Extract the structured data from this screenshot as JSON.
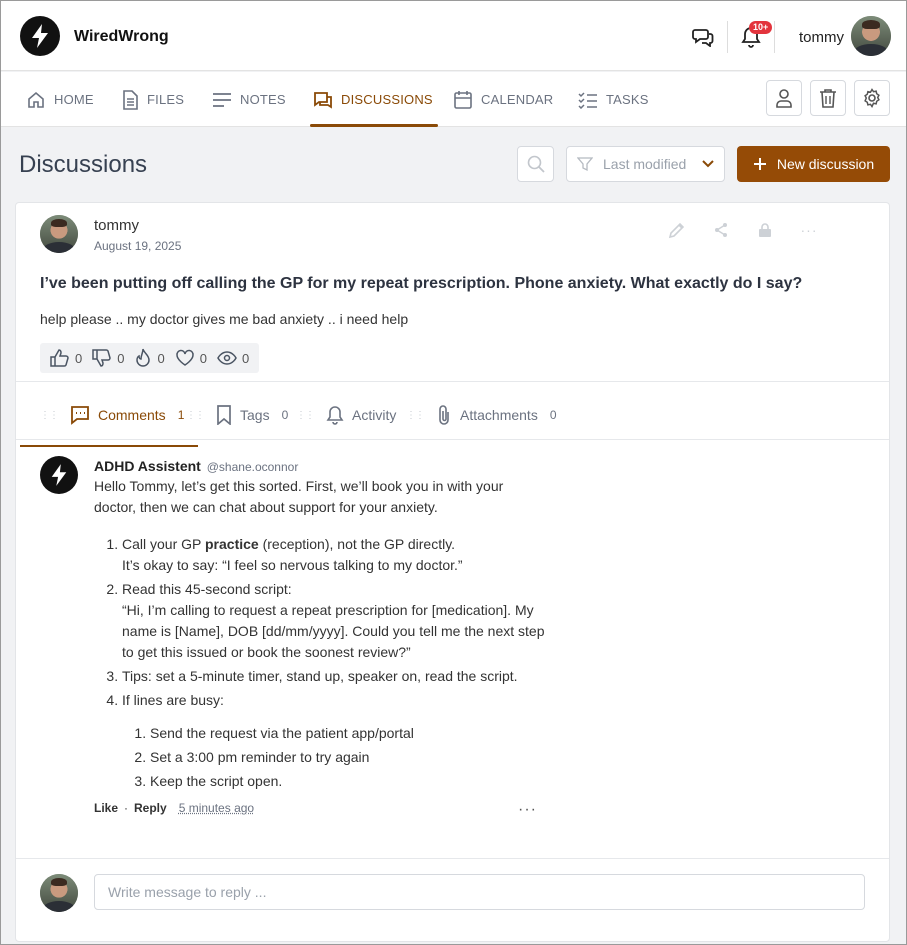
{
  "app": {
    "brand": "WiredWrong",
    "notification_badge": "10+",
    "username": "tommy"
  },
  "nav": {
    "items": [
      {
        "label": "HOME",
        "icon": "home-icon"
      },
      {
        "label": "FILES",
        "icon": "file-icon"
      },
      {
        "label": "NOTES",
        "icon": "notes-icon"
      },
      {
        "label": "DISCUSSIONS",
        "icon": "discussions-icon",
        "active": true
      },
      {
        "label": "CALENDAR",
        "icon": "calendar-icon"
      },
      {
        "label": "TASKS",
        "icon": "tasks-icon"
      }
    ],
    "action_icons": [
      "user-icon",
      "trash-icon",
      "gear-icon"
    ]
  },
  "page": {
    "title": "Discussions",
    "sort_label": "Last modified",
    "new_button_label": "New discussion"
  },
  "post": {
    "author": "tommy",
    "date": "August 19, 2025",
    "title": "I’ve been putting off calling the GP for my repeat prescription. Phone anxiety. What exactly do I say?",
    "body": "help please .. my doctor gives me bad anxiety .. i need help",
    "reactions": {
      "like": "0",
      "dislike": "0",
      "fire": "0",
      "heart": "0",
      "views": "0"
    }
  },
  "tabs": [
    {
      "label": "Comments",
      "count": "1",
      "active": true
    },
    {
      "label": "Tags",
      "count": "0"
    },
    {
      "label": "Activity",
      "count": ""
    },
    {
      "label": "Attachments",
      "count": "0"
    }
  ],
  "comment": {
    "author": "ADHD Assistent",
    "handle": "@shane.oconnor",
    "intro": "Hello Tommy, let’s get this sorted. First, we’ll book you in with your doctor, then we can chat about support for your anxiety.",
    "step1_a": "Call your GP ",
    "step1_b": "practice",
    "step1_c": " (reception), not the GP directly.",
    "step1_d": "It’s okay to say: “I feel so nervous talking to my doctor.”",
    "step2_a": "Read this 45-second script:",
    "step2_b": "“Hi, I’m calling to request a repeat prescription for [medication]. My name is [Name], DOB [dd/mm/yyyy]. Could you tell me the next step to get this issued or book the soonest review?”",
    "step3": "Tips: set a 5-minute timer, stand up, speaker on, read the script.",
    "step4": "If lines are busy:",
    "sub1": "Send the request via the patient app/portal",
    "sub2": "Set a 3:00 pm reminder to try again",
    "sub3": "Keep the script open.",
    "like": "Like",
    "dot": "·",
    "reply": "Reply",
    "time": "5 minutes ago"
  },
  "reply_box": {
    "placeholder": "Write message to reply ..."
  },
  "colors": {
    "accent": "#954b06",
    "active_text": "#8a4a07"
  }
}
